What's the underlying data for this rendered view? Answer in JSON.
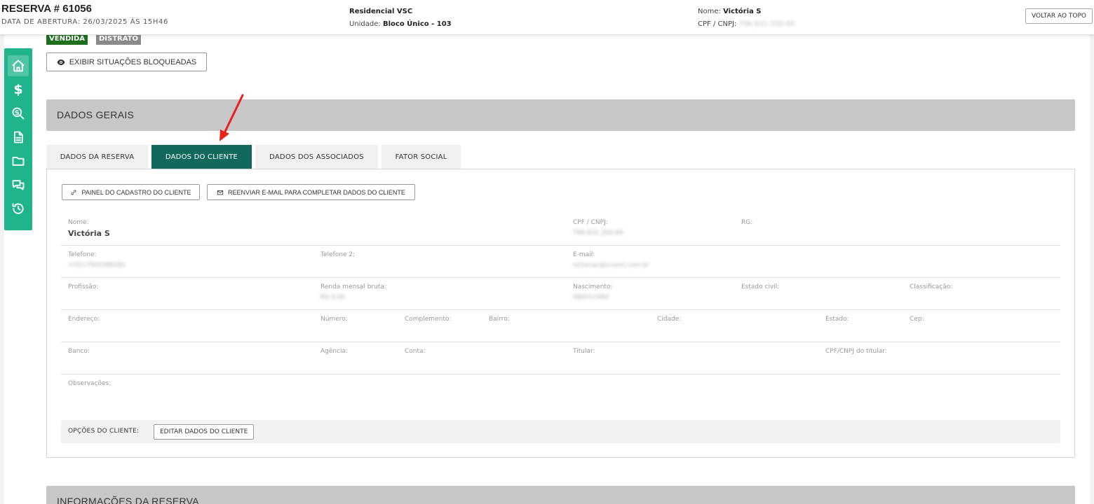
{
  "header": {
    "title": "RESERVA # 61056",
    "opening_date": "DATA DE ABERTURA: 26/03/2025 ÀS 15H46",
    "development": "Residencial VSC",
    "unit_label": "Unidade:",
    "unit_value": "Bloco Único - 103",
    "name_label": "Nome:",
    "name_value": "Victória S",
    "cpf_label": "CPF / CNPJ:",
    "cpf_value": "796.631.250-66",
    "back_to_top": "VOLTAR AO TOPO"
  },
  "sidebar": {
    "items": [
      {
        "icon": "home-icon",
        "active": true
      },
      {
        "icon": "dollar-icon",
        "glyph": "$"
      },
      {
        "icon": "search-money-icon"
      },
      {
        "icon": "document-icon"
      },
      {
        "icon": "folder-icon"
      },
      {
        "icon": "chat-icon"
      },
      {
        "icon": "history-icon"
      }
    ],
    "color": "#1fb48c"
  },
  "badges": {
    "sold": "VENDIDA",
    "termination": "DISTRATO"
  },
  "blocked_button": "EXIBIR SITUAÇÕES BLOQUEADAS",
  "sections": {
    "general": "DADOS GERAIS",
    "reservation_info": "INFORMAÇÕES DA RESERVA"
  },
  "tabs": [
    {
      "label": "DADOS DA RESERVA",
      "active": false
    },
    {
      "label": "DADOS DO CLIENTE",
      "active": true
    },
    {
      "label": "DADOS DOS ASSOCIADOS",
      "active": false
    },
    {
      "label": "FATOR SOCIAL",
      "active": false
    }
  ],
  "active_tab_color": "#10695a",
  "panel": {
    "btn_panel": "PAINEL DO CADASTRO DO CLIENTE",
    "btn_resend": "REENVIAR E-MAIL PARA COMPLETAR DADOS DO CLIENTE",
    "fields": {
      "nome": {
        "label": "Nome:",
        "value": "Victória S"
      },
      "cpf": {
        "label": "CPF / CNPJ:",
        "value": "796.631.250-66"
      },
      "rg": {
        "label": "RG:"
      },
      "telefone": {
        "label": "Telefone:",
        "value": "+5517920286282"
      },
      "telefone2": {
        "label": "Telefone 2:"
      },
      "email": {
        "label": "E-mail:",
        "value": "victoriar@vcorm.com.br"
      },
      "profissao": {
        "label": "Profissão:"
      },
      "renda": {
        "label": "Renda mensal bruta:",
        "value": "R$ 0,00"
      },
      "nascimento": {
        "label": "Nascimento:",
        "value": "08/07/1992"
      },
      "estado_civil": {
        "label": "Estado civil:"
      },
      "classificacao": {
        "label": "Classificação:"
      },
      "endereco": {
        "label": "Endereço:"
      },
      "numero": {
        "label": "Número:"
      },
      "complemento": {
        "label": "Complemento:"
      },
      "bairro": {
        "label": "Bairro:"
      },
      "cidade": {
        "label": "Cidade:"
      },
      "estado": {
        "label": "Estado:"
      },
      "cep": {
        "label": "Cep:"
      },
      "banco": {
        "label": "Banco:"
      },
      "agencia": {
        "label": "Agência:"
      },
      "conta": {
        "label": "Conta:"
      },
      "titular": {
        "label": "Titular:"
      },
      "cpf_titular": {
        "label": "CPF/CNPJ do titular:"
      },
      "observacoes": {
        "label": "Observações:"
      }
    },
    "client_options_label": "OPÇÕES DO CLIENTE:",
    "edit_client_button": "EDITAR DADOS DO CLIENTE"
  },
  "annotation_color": "#e8211b"
}
